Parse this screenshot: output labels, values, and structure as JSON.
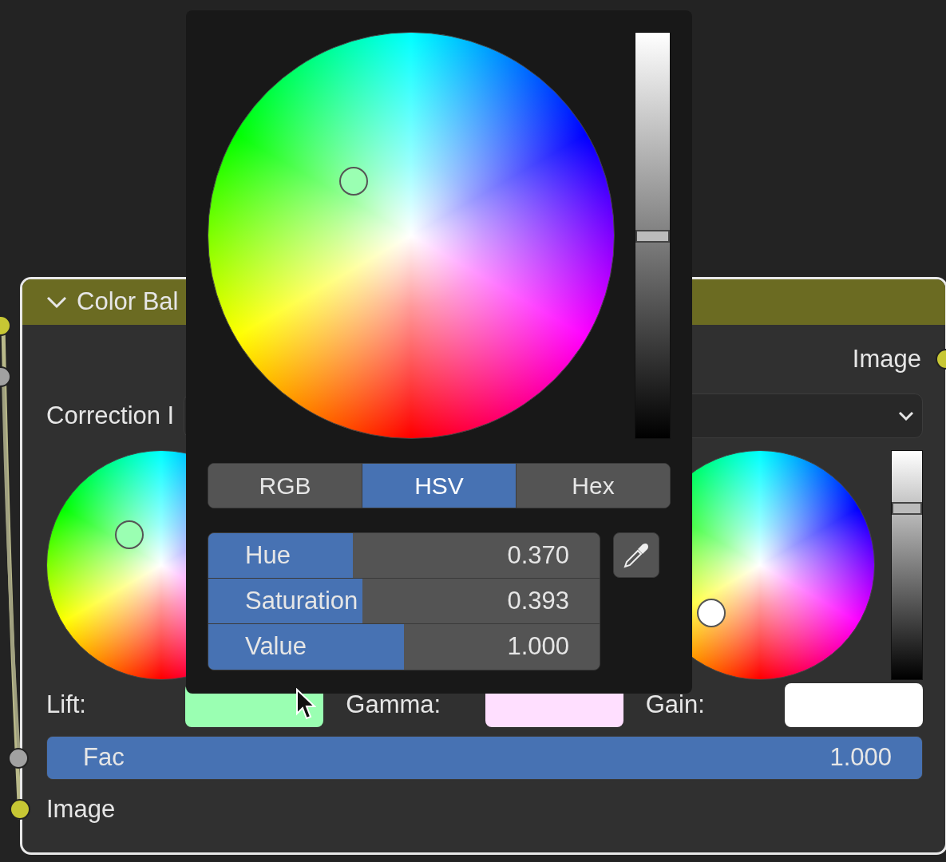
{
  "node": {
    "title": "Color Bal",
    "expanded": true,
    "output": "Image",
    "correction_label": "Correction I",
    "wheels": [
      {
        "label": "Lift:",
        "color": "#9affb2"
      },
      {
        "label": "Gamma:",
        "color": "#ffdfff"
      },
      {
        "label": "Gain:",
        "color": "#ffffff"
      }
    ],
    "gain_value": {
      "level": 0.75
    },
    "fac": {
      "label": "Fac",
      "value": "1.000",
      "level": 1
    },
    "input": "Image"
  },
  "picker": {
    "value_bar": {
      "level": 0.5
    },
    "tabs": [
      {
        "label": "RGB",
        "selected": false
      },
      {
        "label": "HSV",
        "selected": true
      },
      {
        "label": "Hex",
        "selected": false
      }
    ],
    "fields": [
      {
        "label": "Hue",
        "value": "0.370",
        "level": 0.37
      },
      {
        "label": "Saturation",
        "value": "0.393",
        "level": 0.393
      },
      {
        "label": "Value",
        "value": "1.000",
        "level": 0.5
      }
    ]
  }
}
